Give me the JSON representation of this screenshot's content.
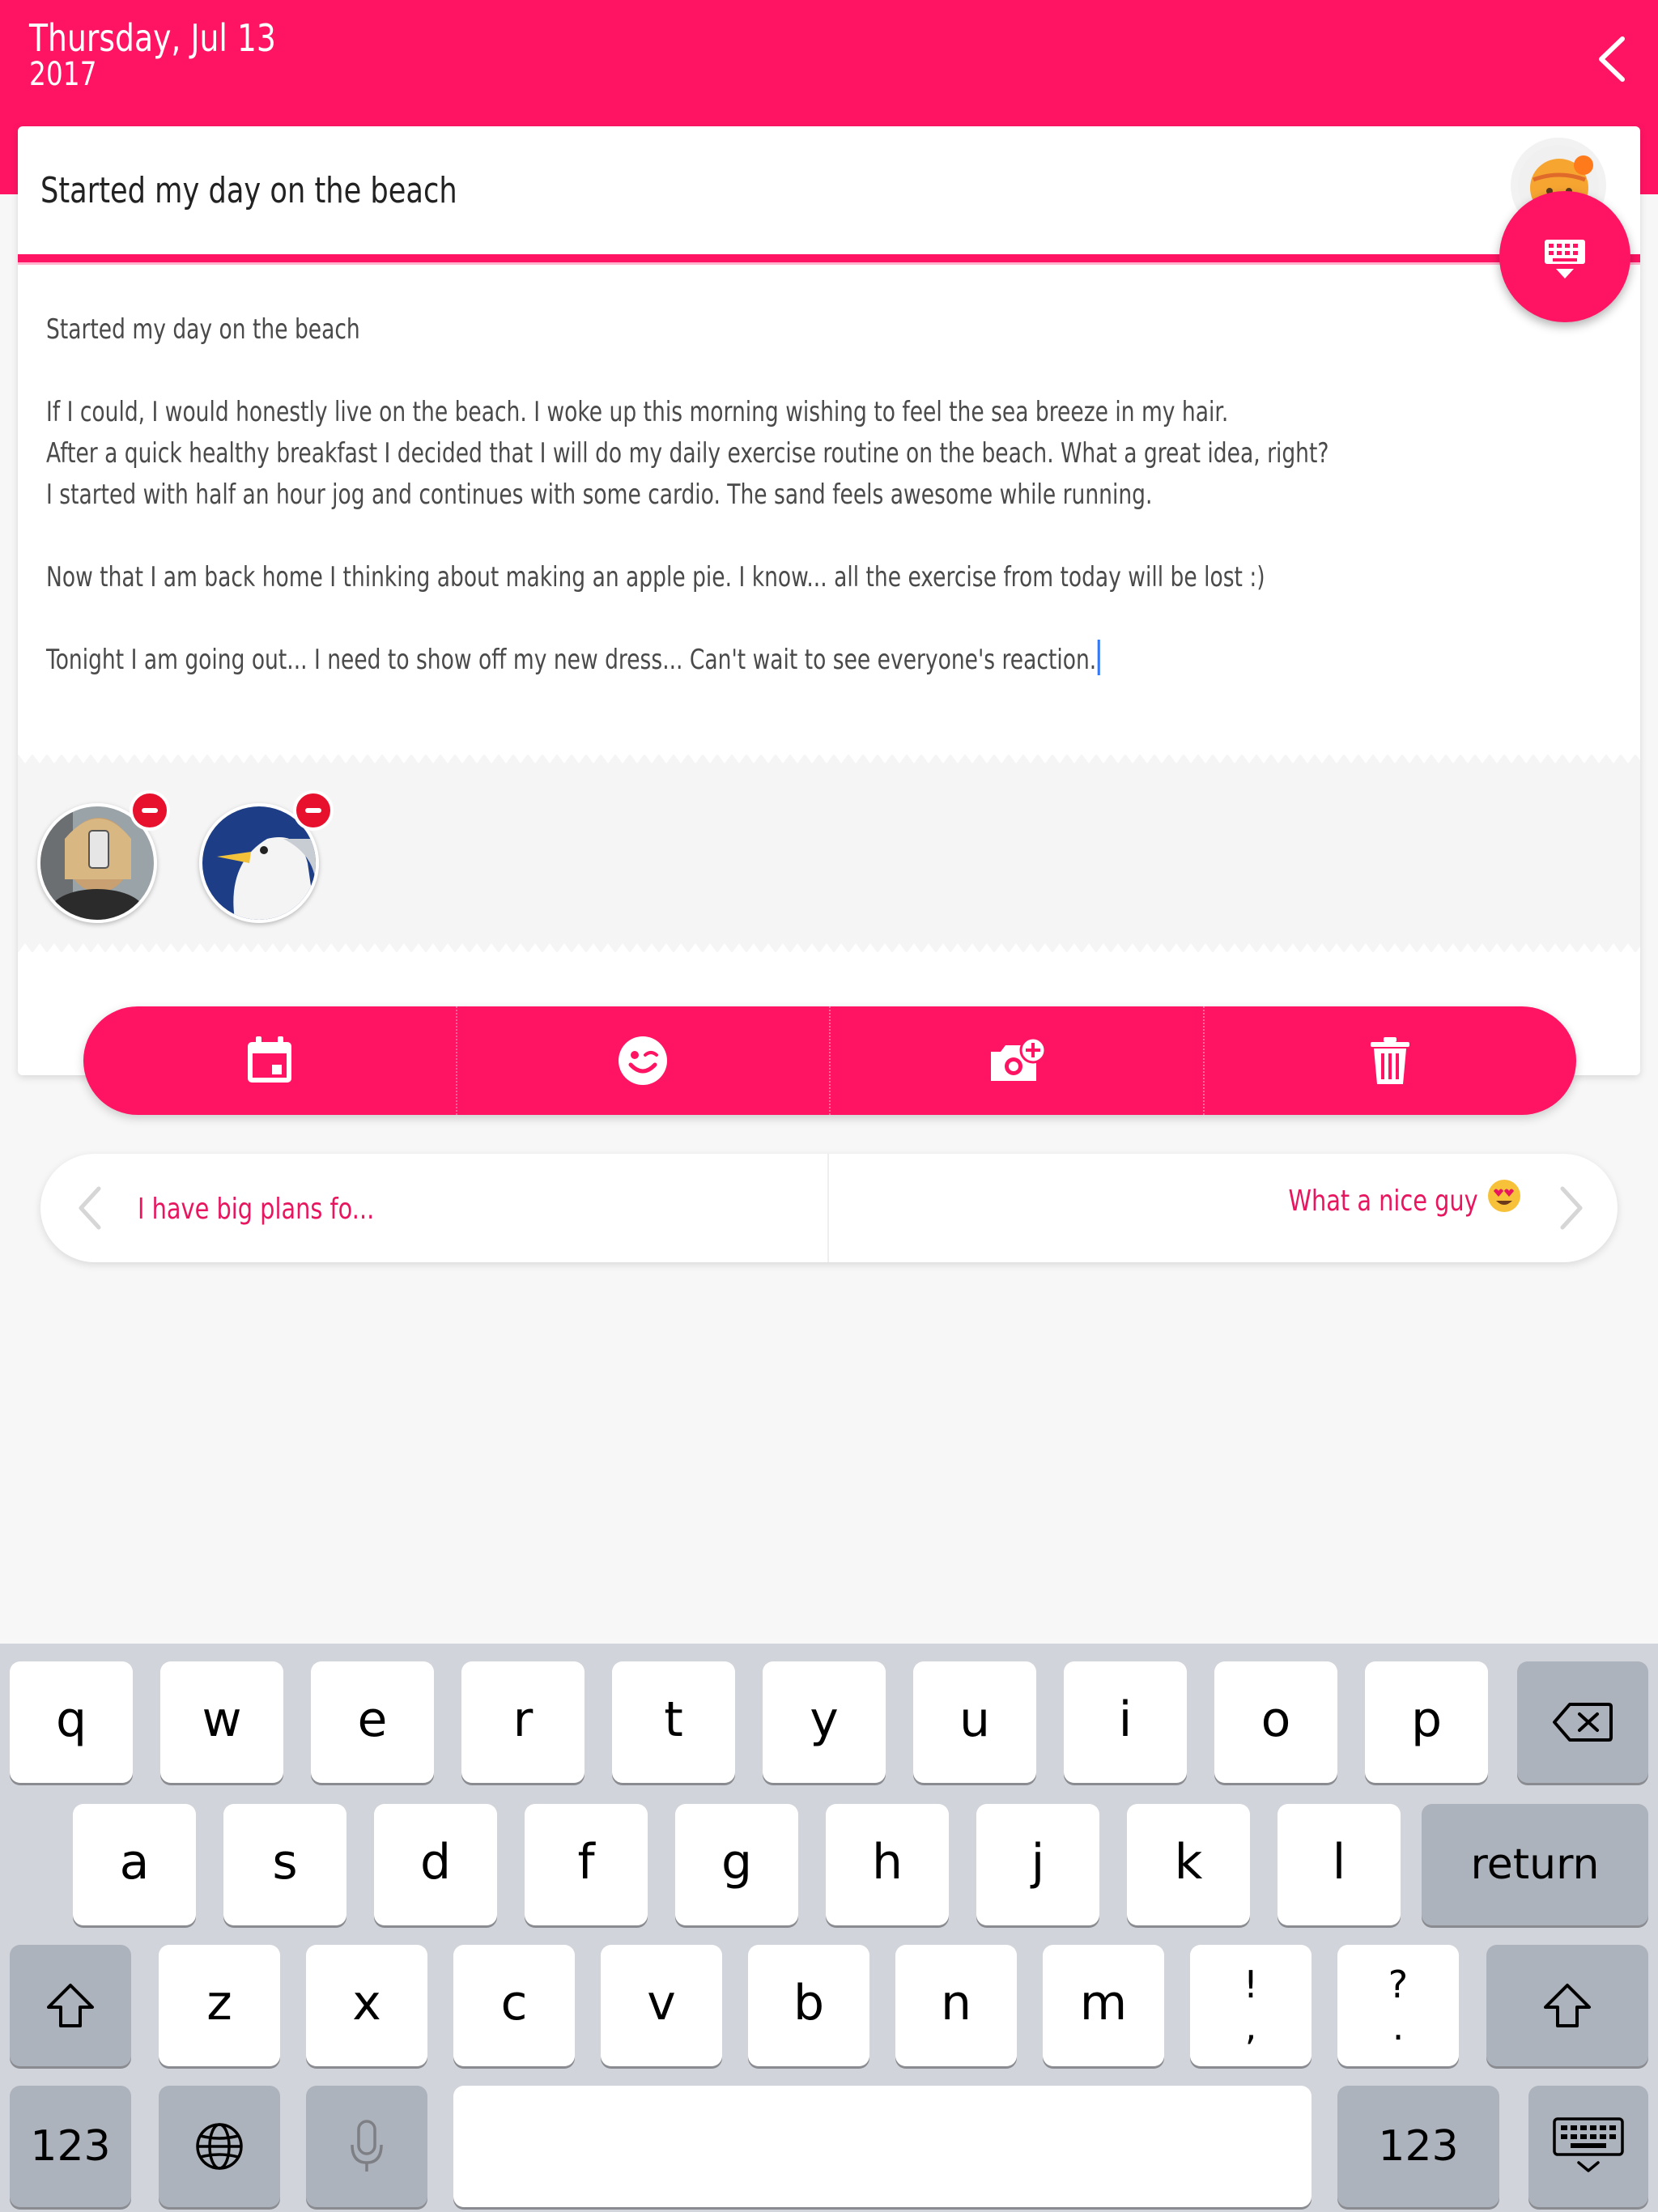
{
  "header": {
    "date": "Thursday, Jul 13",
    "year": "2017",
    "back_icon": "chevron-left-icon",
    "background": "#ff1463"
  },
  "entry": {
    "title": "Started my day on the beach",
    "body_lines": [
      "Started my day on the beach",
      "",
      "If I could, I would honestly live on the beach. I woke up this morning wishing to feel the sea breeze in my hair.",
      "After a quick healthy breakfast I decided that I will do my daily exercise routine on the beach. What a great idea, right?",
      "I started with half an hour jog and continues with some cardio. The sand feels awesome while running.",
      "",
      "Now that I am back home I thinking about making an apple pie. I know... all the exercise from today will be lost :)",
      "",
      "Tonight I am going out... I need to show off my new dress... Can't wait to see everyone's reaction."
    ],
    "mood_icon": "mood-emoji-icon",
    "keyboard_toggle_icon": "keyboard-hide-icon"
  },
  "photos": [
    {
      "name": "selfie-photo",
      "remove_icon": "remove-icon"
    },
    {
      "name": "seagull-photo",
      "remove_icon": "remove-icon"
    }
  ],
  "toolbar": {
    "items": [
      {
        "icon": "calendar-icon"
      },
      {
        "icon": "wink-emoji-icon"
      },
      {
        "icon": "add-photo-icon"
      },
      {
        "icon": "trash-icon"
      }
    ]
  },
  "navigation": {
    "prev_label": "I have big plans fo...",
    "next_label": "What a nice guy",
    "next_emoji": "heart-eyes-emoji-icon"
  },
  "keyboard": {
    "row1": [
      "q",
      "w",
      "e",
      "r",
      "t",
      "y",
      "u",
      "i",
      "o",
      "p"
    ],
    "row2": [
      "a",
      "s",
      "d",
      "f",
      "g",
      "h",
      "j",
      "k",
      "l"
    ],
    "row3": [
      "z",
      "x",
      "c",
      "v",
      "b",
      "n",
      "m"
    ],
    "punct1": {
      "top": "!",
      "bottom": ","
    },
    "punct2": {
      "top": "?",
      "bottom": "."
    },
    "return_label": "return",
    "numbers_label": "123",
    "space_label": ""
  }
}
